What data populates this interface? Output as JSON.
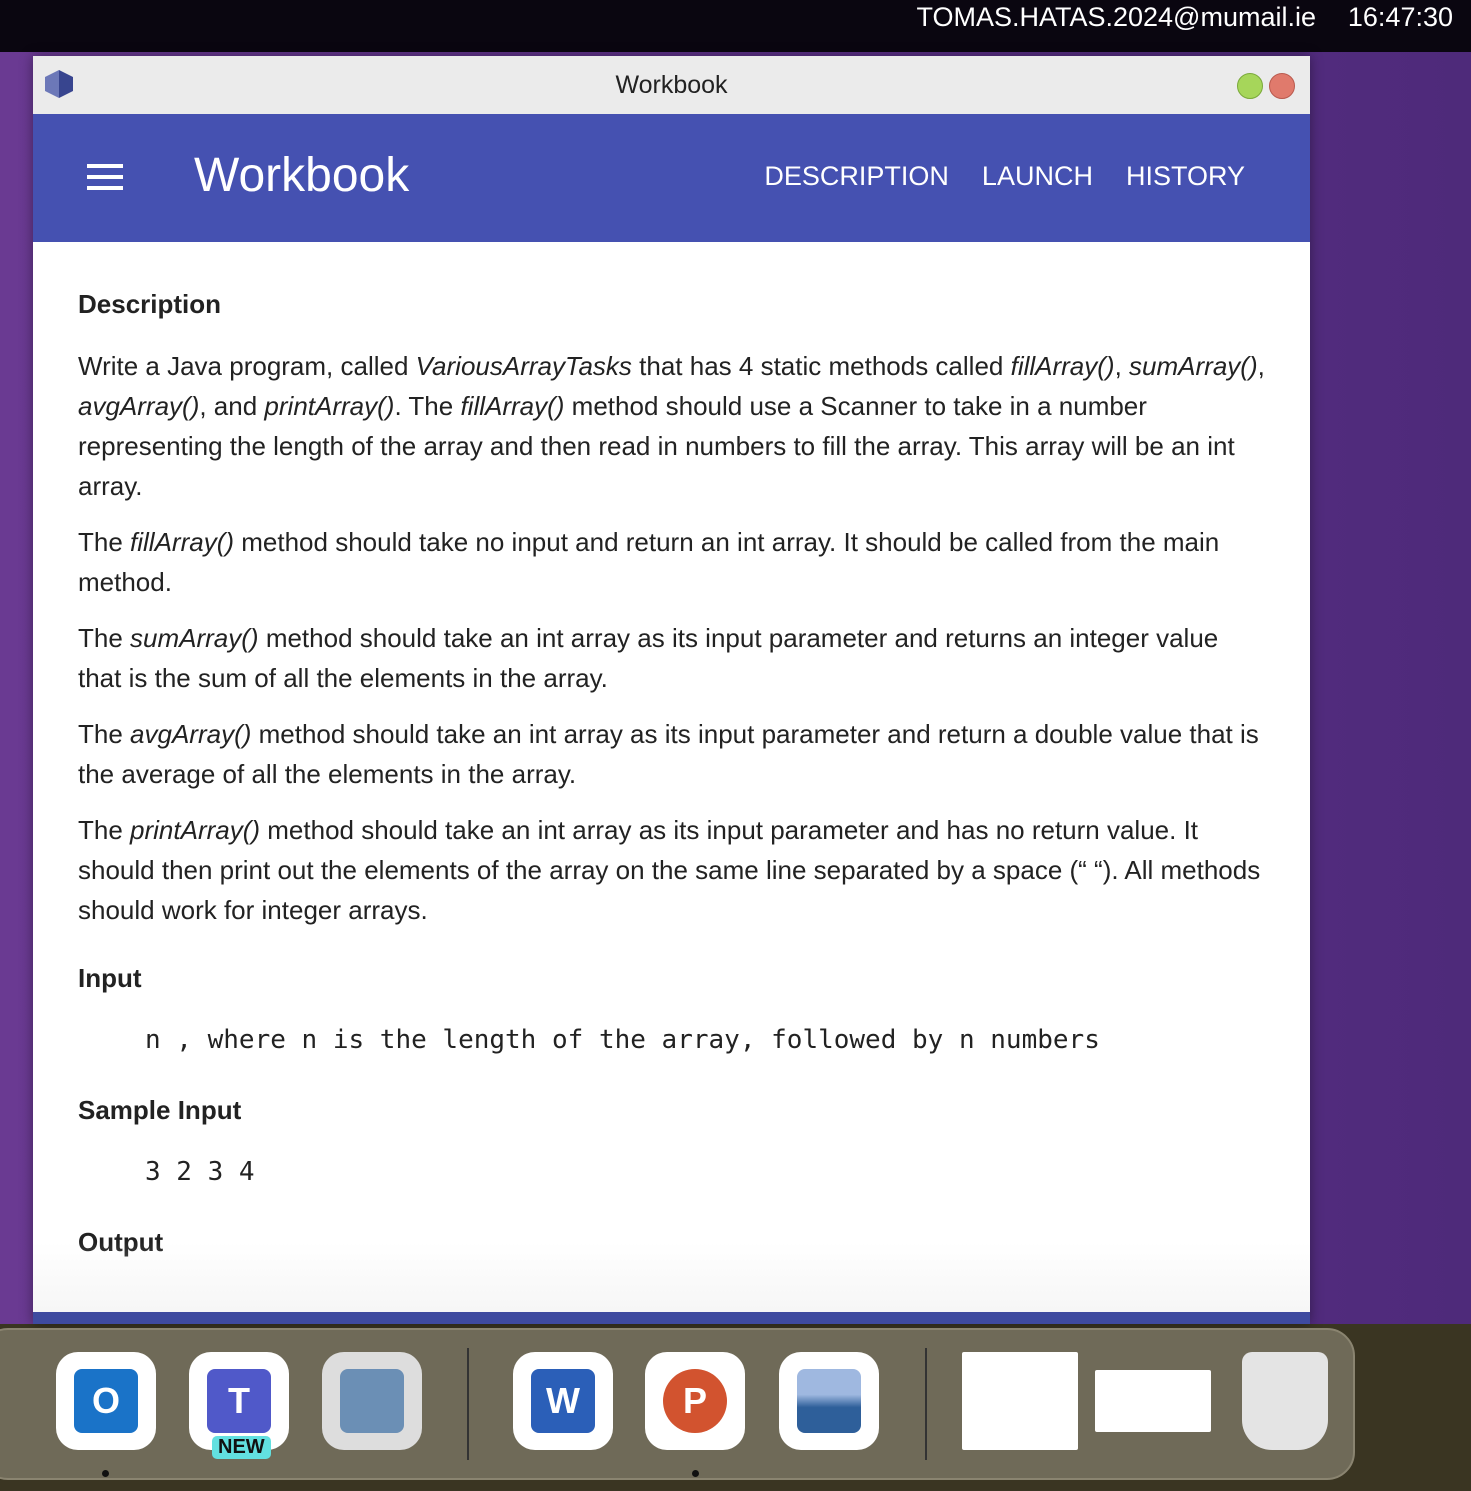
{
  "menubar": {
    "user": "TOMAS.HATAS.2024@mumail.ie",
    "clock": "16:47:30"
  },
  "window": {
    "title": "Workbook"
  },
  "appbar": {
    "title": "Workbook",
    "nav": [
      "DESCRIPTION",
      "LAUNCH",
      "HISTORY"
    ]
  },
  "content": {
    "description_heading": "Description",
    "paragraphs": [
      [
        {
          "t": "Write a Java program, called "
        },
        {
          "t": "VariousArrayTasks",
          "i": true
        },
        {
          "t": " that has 4 static methods called "
        },
        {
          "t": "fillArray()",
          "i": true
        },
        {
          "t": ", "
        },
        {
          "t": "sumArray()",
          "i": true
        },
        {
          "t": ", "
        },
        {
          "t": "avgArray()",
          "i": true
        },
        {
          "t": ", and "
        },
        {
          "t": "printArray()",
          "i": true
        },
        {
          "t": ". The "
        },
        {
          "t": "fillArray()",
          "i": true
        },
        {
          "t": " method should use a Scanner to take in a number representing the length of the array and then read in numbers to fill the array. This array will be an int array."
        }
      ],
      [
        {
          "t": "The "
        },
        {
          "t": "fillArray()",
          "i": true
        },
        {
          "t": " method should take no input and return an int array. It should be called from the main method."
        }
      ],
      [
        {
          "t": "The "
        },
        {
          "t": "sumArray()",
          "i": true
        },
        {
          "t": " method should take an int array as its input parameter and returns an integer value that is the sum of all the elements in the array."
        }
      ],
      [
        {
          "t": "The "
        },
        {
          "t": "avgArray()",
          "i": true
        },
        {
          "t": " method should take an int array as its input parameter and return a double value that is the average of all the elements in the array."
        }
      ],
      [
        {
          "t": "The "
        },
        {
          "t": "printArray()",
          "i": true
        },
        {
          "t": " method should take an int array as its input parameter and has no return value. It should then print out the elements of the array on the same line separated by a space (“ “). All methods should work for integer arrays."
        }
      ]
    ],
    "input_heading": "Input",
    "input_text": "n , where n is the length of the array, followed by n numbers",
    "sample_input_heading": "Sample Input",
    "sample_input": "3 2 3 4",
    "output_heading": "Output"
  },
  "dock": {
    "apps": [
      "Outlook",
      "Teams",
      "BlueJ",
      "Word",
      "PowerPoint",
      "Preview"
    ],
    "teams_badge": "NEW"
  }
}
